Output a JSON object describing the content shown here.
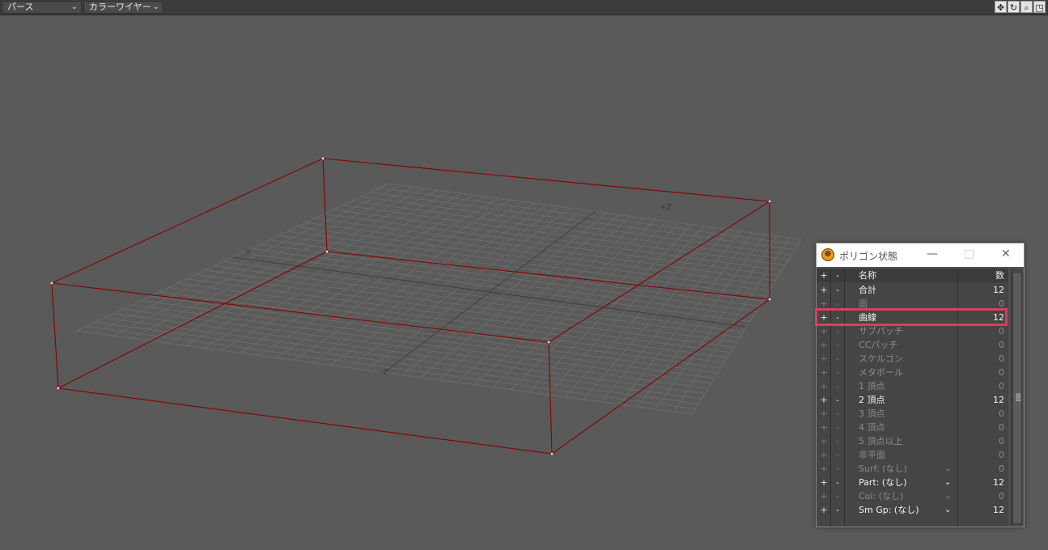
{
  "topbar": {
    "view_mode": "パース",
    "render_mode": "カラーワイヤー",
    "icons": [
      "move-icon",
      "rotate-icon",
      "zoom-icon",
      "maximize-icon"
    ]
  },
  "viewport": {
    "axis_labels": {
      "pos_z": "+Z",
      "neg_x": "-X",
      "neg_z": "-Z"
    },
    "colors": {
      "background": "#5a5a5a",
      "grid": "#6b6b6b",
      "box_edges": "#8b0000"
    }
  },
  "poly_window": {
    "title": "ポリゴン状態",
    "header": {
      "plus": "+",
      "minus": "-",
      "name": "名称",
      "count": "数"
    },
    "rows": [
      {
        "name": "合計",
        "count": "12",
        "active": true
      },
      {
        "name": "面",
        "count": "0",
        "active": false
      },
      {
        "name": "曲線",
        "count": "12",
        "active": true
      },
      {
        "name": "サブパッチ",
        "count": "0",
        "active": false
      },
      {
        "name": "CCパッチ",
        "count": "0",
        "active": false
      },
      {
        "name": "スケルゴン",
        "count": "0",
        "active": false
      },
      {
        "name": "メタボール",
        "count": "0",
        "active": false
      },
      {
        "name": "1 頂点",
        "count": "0",
        "active": false
      },
      {
        "name": "2 頂点",
        "count": "12",
        "active": true
      },
      {
        "name": "3 頂点",
        "count": "0",
        "active": false
      },
      {
        "name": "4 頂点",
        "count": "0",
        "active": false
      },
      {
        "name": "5 頂点以上",
        "count": "0",
        "active": false
      },
      {
        "name": "非平面",
        "count": "0",
        "active": false
      },
      {
        "name": "Surf: (なし)",
        "count": "0",
        "active": false,
        "dropdown": true
      },
      {
        "name": "Part: (なし)",
        "count": "12",
        "active": true,
        "dropdown": true
      },
      {
        "name": "Col: (なし)",
        "count": "0",
        "active": false,
        "dropdown": true
      },
      {
        "name": "Sm Gp: (なし)",
        "count": "12",
        "active": true,
        "dropdown": true
      }
    ],
    "highlight_color": "#e03c5a"
  }
}
